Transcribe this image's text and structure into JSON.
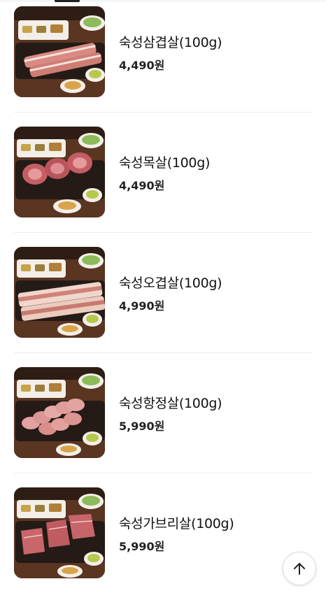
{
  "menu": {
    "items": [
      {
        "name": "숙성삼겹살(100g)",
        "price": "4,490원",
        "photo": "pork-belly-strips"
      },
      {
        "name": "숙성목살(100g)",
        "price": "4,490원",
        "photo": "pork-neck-rolls"
      },
      {
        "name": "숙성오겹살(100g)",
        "price": "4,990원",
        "photo": "skin-on-pork-belly-slabs"
      },
      {
        "name": "숙성항정살(100g)",
        "price": "5,990원",
        "photo": "pork-jowl-slices"
      },
      {
        "name": "숙성가브리살(100g)",
        "price": "5,990원",
        "photo": "pork-shoulder-cuts"
      }
    ]
  },
  "scroll_top_button": {
    "icon": "arrow-up-icon"
  },
  "colors": {
    "background": "#ffffff",
    "divider": "#eeeeee",
    "text": "#111111",
    "wood": "#4a2c1c",
    "meat": "#d98a82"
  }
}
